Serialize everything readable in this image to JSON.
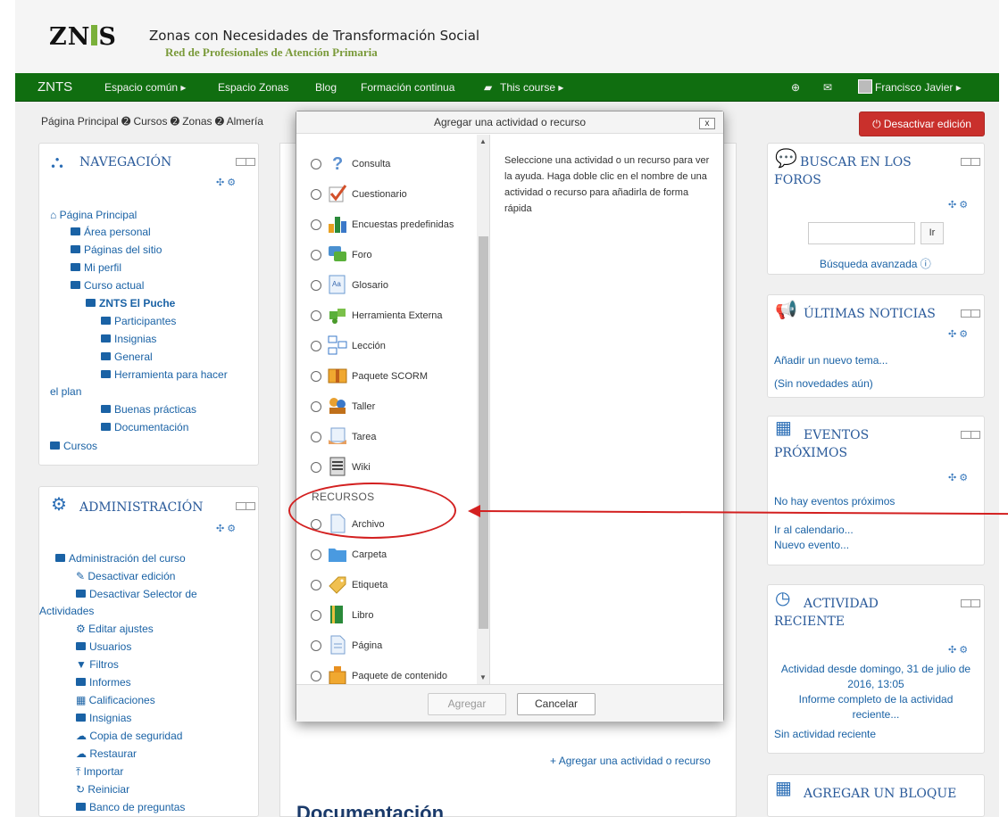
{
  "header": {
    "logo_text": "ZNTS",
    "site_title": "Zonas con Necesidades de Transformación Social",
    "site_subtitle": "Red de Profesionales de Atención Primaria"
  },
  "navbar": {
    "brand": "ZNTS",
    "items": [
      "Espacio común ▸",
      "Espacio Zonas",
      "Blog",
      "Formación continua",
      "This course ▸"
    ],
    "user": "Francisco Javier ▸"
  },
  "breadcrumb": [
    "Página Principal",
    "Cursos",
    "Zonas",
    "Almería"
  ],
  "edit_button": "Desactivar edición",
  "navegacion": {
    "title": "NAVEGACIÓN",
    "items": [
      "Página Principal",
      "Área personal",
      "Páginas del sitio",
      "Mi perfil",
      "Curso actual",
      "ZNTS El Puche",
      "Participantes",
      "Insignias",
      "General",
      "Herramienta para hacer",
      "el plan",
      "Buenas prácticas",
      "Documentación",
      "Cursos"
    ]
  },
  "administracion": {
    "title": "ADMINISTRACIÓN",
    "items": [
      "Administración del curso",
      "Desactivar edición",
      "Desactivar Selector de",
      "Actividades",
      "Editar ajustes",
      "Usuarios",
      "Filtros",
      "Informes",
      "Calificaciones",
      "Insignias",
      "Copia de seguridad",
      "Restaurar",
      "Importar",
      "Reiniciar",
      "Banco de preguntas"
    ]
  },
  "buscar": {
    "title_line1": "BUSCAR EN LOS",
    "title_line2": "FOROS",
    "button": "Ir",
    "advanced": "Búsqueda avanzada"
  },
  "noticias": {
    "title": "ÚLTIMAS NOTICIAS",
    "add": "Añadir un nuevo tema...",
    "none": "(Sin novedades aún)"
  },
  "eventos": {
    "title_line1": "EVENTOS",
    "title_line2": "PRÓXIMOS",
    "none": "No hay eventos próximos",
    "calendar": "Ir al calendario...",
    "new": "Nuevo evento..."
  },
  "actividad": {
    "title_line1": "ACTIVIDAD",
    "title_line2": "RECIENTE",
    "since1": "Actividad desde domingo, 31 de julio de",
    "since2": "2016, 13:05",
    "report1": "Informe completo de la actividad",
    "report2": "reciente...",
    "none": "Sin actividad reciente"
  },
  "agregar_bloque": {
    "title": "AGREGAR UN BLOQUE"
  },
  "course": {
    "add_activity": "Agregar una actividad o recurso",
    "section_title": "Documentación"
  },
  "dialog": {
    "title": "Agregar una actividad o recurso",
    "close": "x",
    "activities": [
      "Consulta",
      "Cuestionario",
      "Encuestas predefinidas",
      "Foro",
      "Glosario",
      "Herramienta Externa",
      "Lección",
      "Paquete SCORM",
      "Taller",
      "Tarea",
      "Wiki"
    ],
    "resources_heading": "RECURSOS",
    "resources": [
      "Archivo",
      "Carpeta",
      "Etiqueta",
      "Libro",
      "Página",
      "Paquete de contenido"
    ],
    "help": "Seleccione una actividad o un recurso para ver la ayuda. Haga doble clic en el nombre de una actividad o recurso para añadirla de forma rápida",
    "add_button": "Agregar",
    "cancel_button": "Cancelar"
  },
  "colors": {
    "navbar": "#106e10",
    "accent": "#2a6db5",
    "danger": "#c9302c",
    "annotation": "#d32020"
  }
}
